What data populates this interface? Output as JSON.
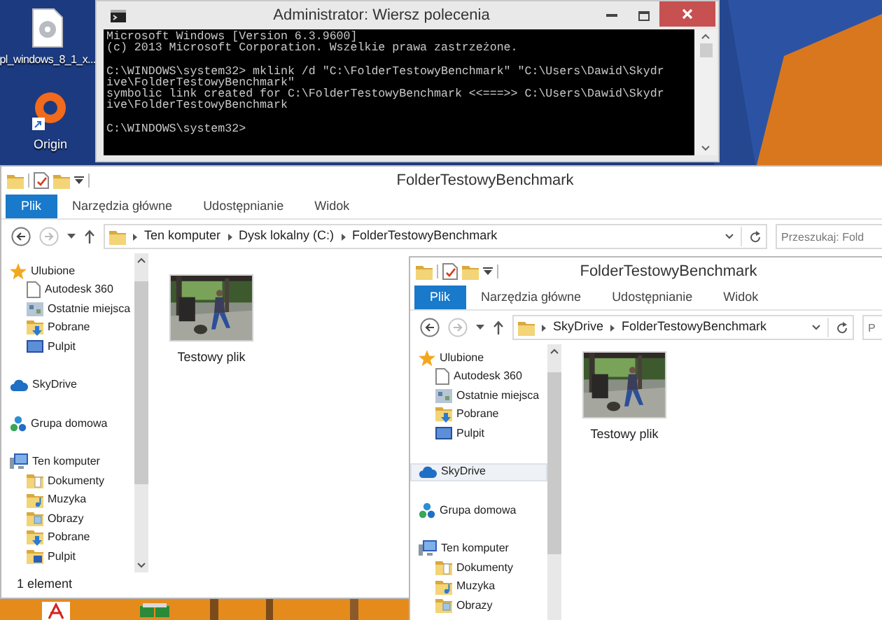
{
  "desktop_icons": [
    {
      "label": "pl_windows_8_1_x..."
    },
    {
      "label": "Origin"
    }
  ],
  "console_window": {
    "title": "Administrator: Wiersz polecenia",
    "blocks": [
      [
        "Microsoft Windows [Version 6.3.9600]",
        "(c) 2013 Microsoft Corporation. Wszelkie prawa zastrzeżone."
      ],
      [
        "C:\\WINDOWS\\system32> mklink /d \"C:\\FolderTestowyBenchmark\" \"C:\\Users\\Dawid\\Skydr",
        "ive\\FolderTestowyBenchmark\"",
        "symbolic link created for C:\\FolderTestowyBenchmark <<===>> C:\\Users\\Dawid\\Skydr",
        "ive\\FolderTestowyBenchmark"
      ],
      [
        "C:\\WINDOWS\\system32>"
      ]
    ]
  },
  "explorer_windows": [
    {
      "title": "FolderTestowyBenchmark",
      "tabs": [
        {
          "label": "Plik",
          "kind": "file"
        },
        {
          "label": "Narzędzia główne",
          "kind": "tab"
        },
        {
          "label": "Udostępnianie",
          "kind": "tab"
        },
        {
          "label": "Widok",
          "kind": "tab"
        }
      ],
      "address": [
        "Ten komputer",
        "Dysk lokalny (C:)",
        "FolderTestowyBenchmark"
      ],
      "search_placeholder": "Przeszukaj: Fold",
      "navigation": [
        {
          "label": "Ulubione",
          "selected": false,
          "children": [
            {
              "label": "Autodesk 360",
              "selected": false
            },
            {
              "label": "Ostatnie miejsca",
              "selected": false
            },
            {
              "label": "Pobrane",
              "selected": false
            },
            {
              "label": "Pulpit",
              "selected": false
            }
          ]
        },
        {
          "label": "SkyDrive",
          "selected": false
        },
        {
          "label": "Grupa domowa",
          "selected": false
        },
        {
          "label": "Ten komputer",
          "selected": false,
          "children": [
            {
              "label": "Dokumenty",
              "selected": false
            },
            {
              "label": "Muzyka",
              "selected": false
            },
            {
              "label": "Obrazy",
              "selected": false
            },
            {
              "label": "Pobrane",
              "selected": false
            },
            {
              "label": "Pulpit",
              "selected": false
            }
          ]
        }
      ],
      "files": [
        {
          "name": "Testowy plik",
          "kind": "picture"
        }
      ],
      "status": "1 element"
    },
    {
      "title": "FolderTestowyBenchmark",
      "tabs": [
        {
          "label": "Plik",
          "kind": "file"
        },
        {
          "label": "Narzędzia główne",
          "kind": "tab"
        },
        {
          "label": "Udostępnianie",
          "kind": "tab"
        },
        {
          "label": "Widok",
          "kind": "tab"
        }
      ],
      "address": [
        "SkyDrive",
        "FolderTestowyBenchmark"
      ],
      "search_placeholder": "P",
      "navigation": [
        {
          "label": "Ulubione",
          "selected": false,
          "children": [
            {
              "label": "Autodesk 360",
              "selected": false
            },
            {
              "label": "Ostatnie miejsca",
              "selected": false
            },
            {
              "label": "Pobrane",
              "selected": false
            },
            {
              "label": "Pulpit",
              "selected": false
            }
          ]
        },
        {
          "label": "SkyDrive",
          "selected": true
        },
        {
          "label": "Grupa domowa",
          "selected": false
        },
        {
          "label": "Ten komputer",
          "selected": false,
          "children": [
            {
              "label": "Dokumenty",
              "selected": false
            },
            {
              "label": "Muzyka",
              "selected": false
            },
            {
              "label": "Obrazy",
              "selected": false
            }
          ]
        }
      ],
      "files": [
        {
          "name": "Testowy plik",
          "kind": "picture"
        }
      ]
    }
  ]
}
